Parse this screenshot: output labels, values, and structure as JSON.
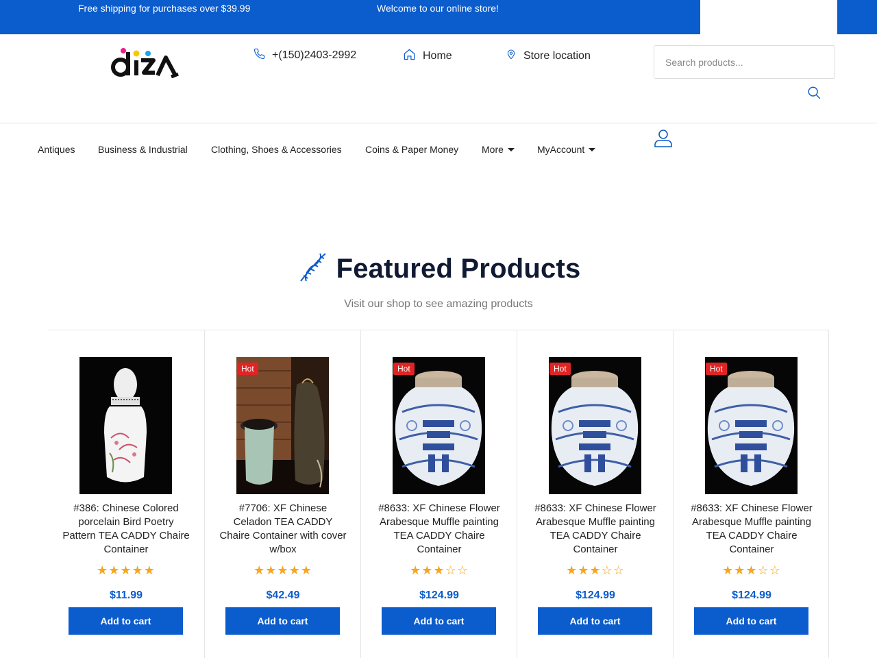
{
  "topbar": {
    "left_text": "Free shipping for purchases over $39.99",
    "center_text": "Welcome to our online store!"
  },
  "header": {
    "logo_text": "diza",
    "phone": "+(150)2403-2992",
    "home": "Home",
    "store": "Store location",
    "search_placeholder": "Search products..."
  },
  "nav": {
    "items": [
      "Antiques",
      "Business & Industrial",
      "Clothing, Shoes & Accessories",
      "Coins & Paper Money",
      "More",
      "MyAccount"
    ]
  },
  "featured": {
    "title": "Featured Products",
    "subtitle": "Visit our shop to see amazing products"
  },
  "products": [
    {
      "title": "#386: Chinese Colored porcelain Bird Poetry Pattern TEA CADDY Chaire Container",
      "rating": 5,
      "price": "$11.99",
      "badge": "",
      "button": "Add to cart",
      "image": "white-vase"
    },
    {
      "title": "#7706: XF Chinese Celadon TEA CADDY Chaire Container with cover w/box",
      "rating": 5,
      "price": "$42.49",
      "badge": "Hot",
      "button": "Add to cart",
      "image": "celadon-caddy"
    },
    {
      "title": "#8633: XF Chinese Flower Arabesque Muffle painting TEA CADDY Chaire Container",
      "rating": 3,
      "price": "$124.99",
      "badge": "Hot",
      "button": "Add to cart",
      "image": "blue-jar"
    },
    {
      "title": "#8633: XF Chinese Flower Arabesque Muffle painting TEA CADDY Chaire Container",
      "rating": 3,
      "price": "$124.99",
      "badge": "Hot",
      "button": "Add to cart",
      "image": "blue-jar"
    },
    {
      "title": "#8633: XF Chinese Flower Arabesque Muffle painting TEA CADDY Chaire Container",
      "rating": 3,
      "price": "$124.99",
      "badge": "Hot",
      "button": "Add to cart",
      "image": "blue-jar"
    }
  ],
  "colors": {
    "brand_blue": "#0b5ccc",
    "badge_red": "#e02424",
    "star_gold": "#f5a623"
  },
  "icons": {
    "phone": "phone-icon",
    "home": "home-icon",
    "store": "map-pin-icon",
    "search": "search-icon",
    "user": "user-icon",
    "featured": "dna-icon"
  }
}
